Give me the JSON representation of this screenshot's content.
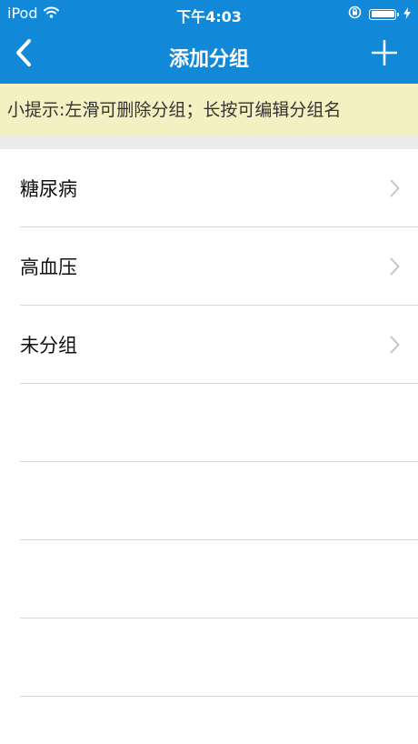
{
  "status_bar": {
    "carrier": "iPod",
    "time": "下午4:03"
  },
  "nav": {
    "title": "添加分组",
    "back_icon": "chevron-left-icon",
    "add_icon": "plus-icon"
  },
  "tip": {
    "text": "小提示:左滑可删除分组；长按可编辑分组名"
  },
  "groups": [
    {
      "label": "糖尿病"
    },
    {
      "label": "高血压"
    },
    {
      "label": "未分组"
    }
  ],
  "colors": {
    "header": "#1188d8",
    "tip_background": "#f4f0c2"
  }
}
